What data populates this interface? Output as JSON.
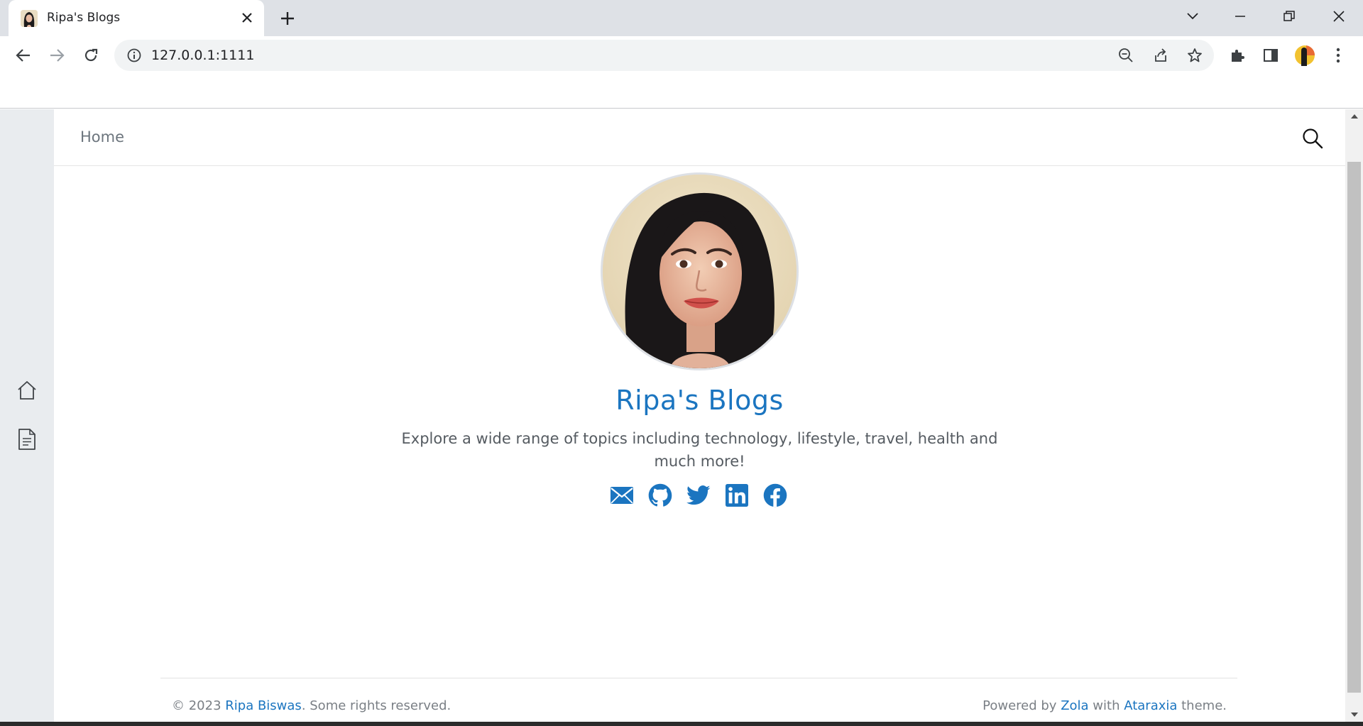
{
  "browser": {
    "tab_title": "Ripa's Blogs",
    "url": "127.0.0.1:1111"
  },
  "nav": {
    "home_label": "Home"
  },
  "hero": {
    "title": "Ripa's Blogs",
    "description": "Explore a wide range of topics including technology, lifestyle, travel, health and much more!",
    "socials": [
      "mail-icon",
      "github-icon",
      "twitter-icon",
      "linkedin-icon",
      "facebook-icon"
    ]
  },
  "footer": {
    "copyright_prefix": "© 2023 ",
    "author": "Ripa Biswas",
    "copyright_suffix": ". Some rights reserved.",
    "powered_prefix": "Powered by ",
    "engine": "Zola",
    "with_text": " with ",
    "theme": "Ataraxia",
    "theme_suffix": " theme."
  },
  "colors": {
    "accent": "#1b75c0",
    "sidebar_bg": "#e9ecef",
    "tabstrip_bg": "#dee1e6"
  }
}
